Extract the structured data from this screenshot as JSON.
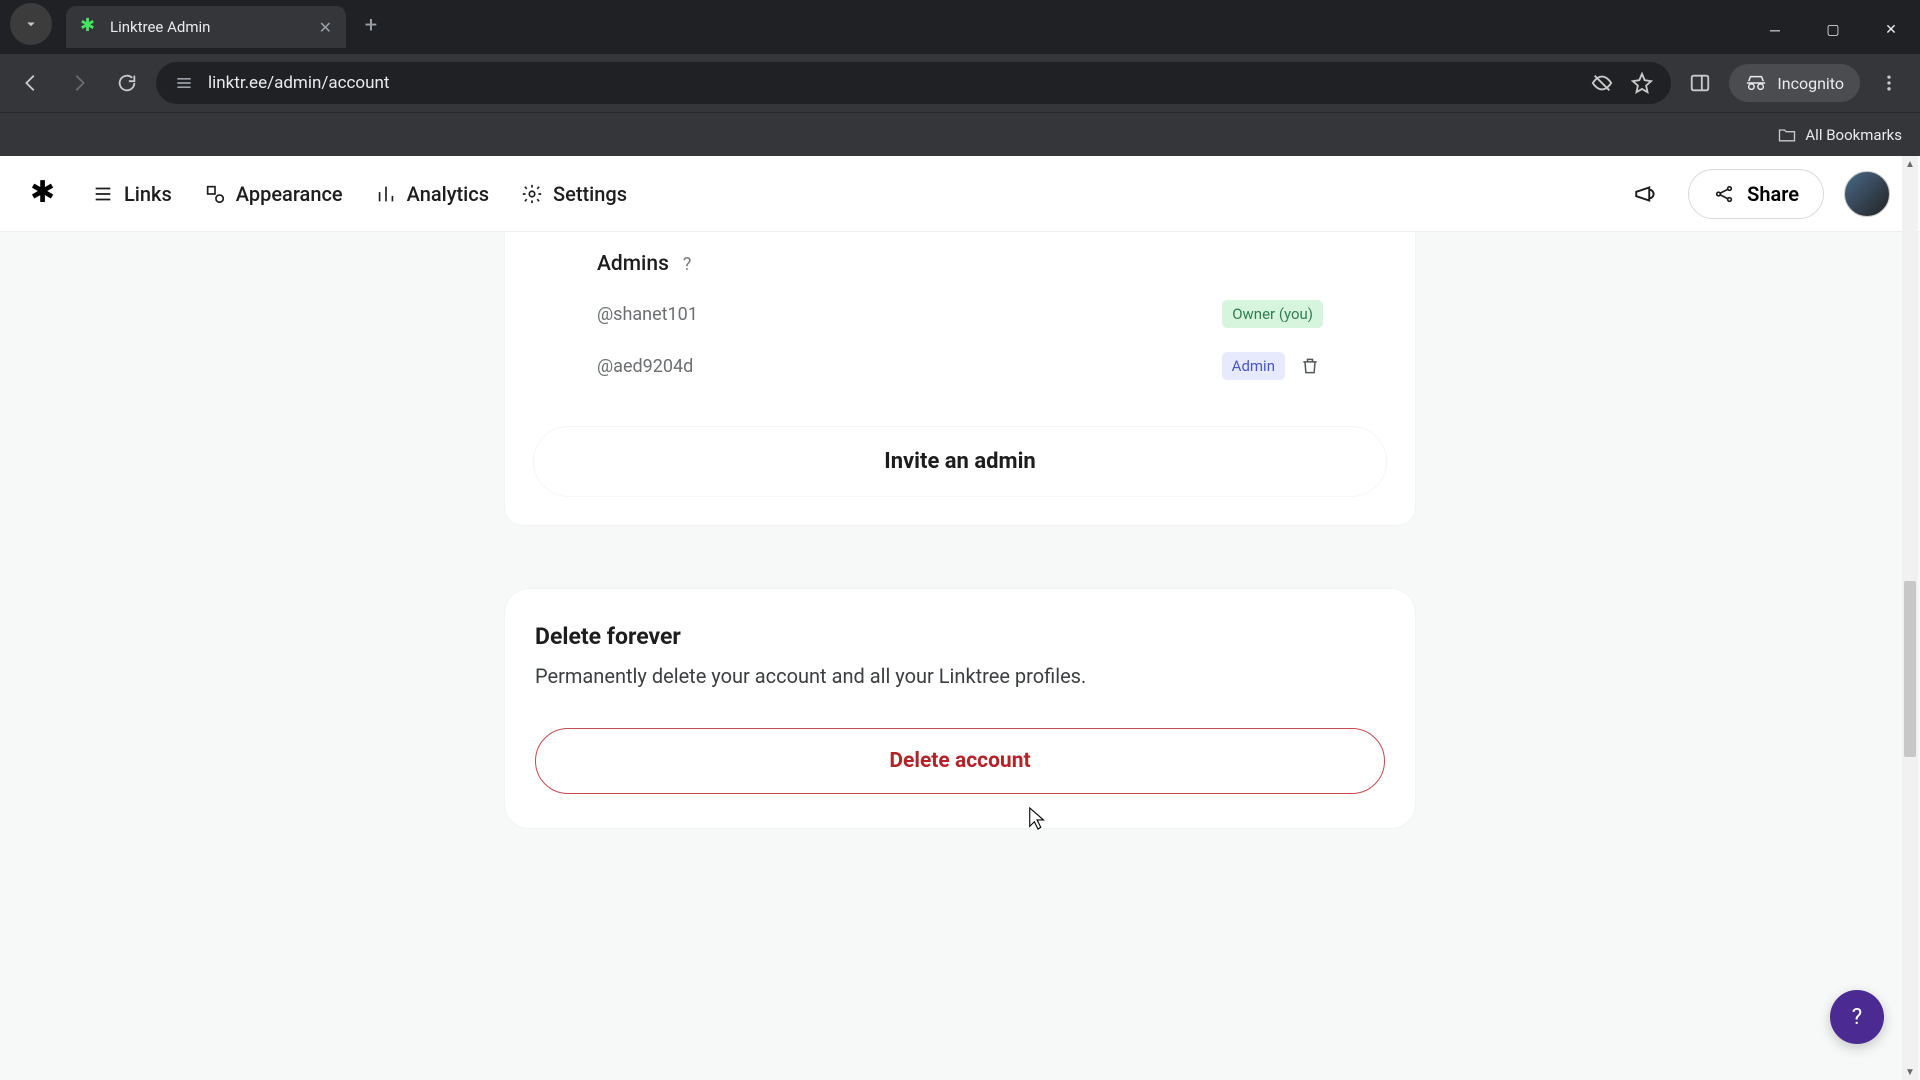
{
  "browser": {
    "tab_title": "Linktree Admin",
    "url": "linktr.ee/admin/account",
    "bookmarks_label": "All Bookmarks",
    "incognito_label": "Incognito"
  },
  "header": {
    "nav": {
      "links": "Links",
      "appearance": "Appearance",
      "analytics": "Analytics",
      "settings": "Settings"
    },
    "share": "Share"
  },
  "admins": {
    "title": "Admins",
    "help": "?",
    "rows": [
      {
        "user": "@shanet101",
        "role": "Owner (you)",
        "role_kind": "owner"
      },
      {
        "user": "@aed9204d",
        "role": "Admin",
        "role_kind": "admin"
      }
    ],
    "invite_label": "Invite an admin"
  },
  "delete": {
    "title": "Delete forever",
    "desc": "Permanently delete your account and all your Linktree profiles.",
    "button": "Delete account"
  },
  "help_fab": "?"
}
